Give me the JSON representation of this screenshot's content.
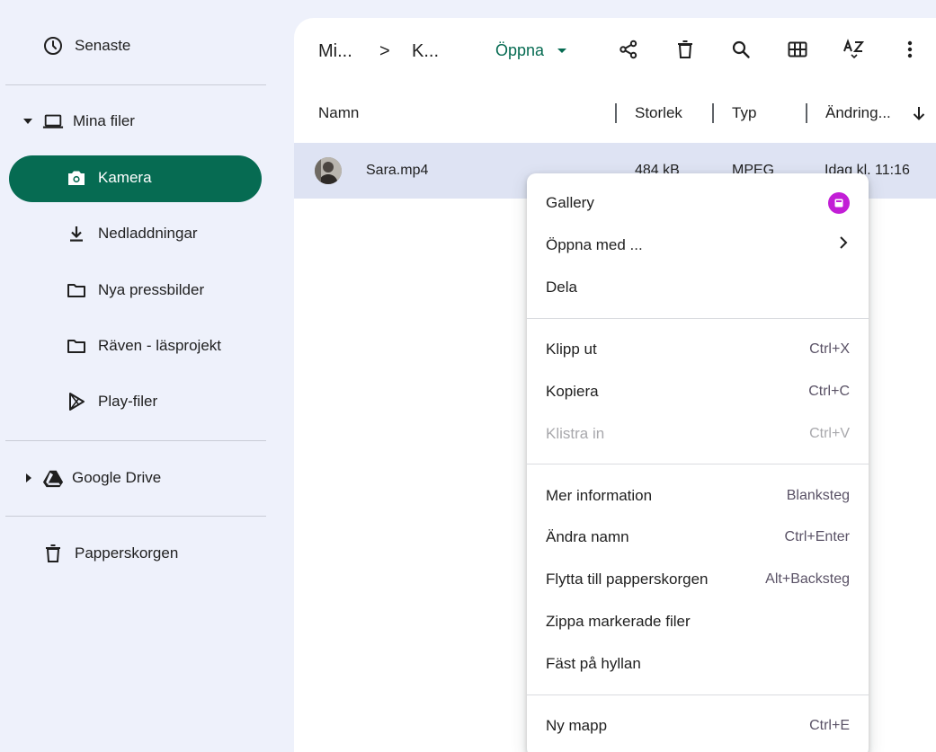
{
  "sidebar": {
    "recent": "Senaste",
    "my_files": "Mina filer",
    "items": [
      {
        "label": "Kamera"
      },
      {
        "label": "Nedladdningar"
      },
      {
        "label": "Nya pressbilder"
      },
      {
        "label": "Räven - läsprojekt"
      },
      {
        "label": "Play-filer"
      }
    ],
    "google_drive": "Google Drive",
    "trash": "Papperskorgen"
  },
  "toolbar": {
    "crumb1": "Mi...",
    "crumb_sep": ">",
    "crumb2": "K...",
    "open_label": "Öppna"
  },
  "columns": {
    "name": "Namn",
    "size": "Storlek",
    "type": "Typ",
    "modified": "Ändring..."
  },
  "files": [
    {
      "name": "Sara.mp4",
      "size": "484 kB",
      "type": "MPEG",
      "modified": "Idag kl. 11:16"
    }
  ],
  "context_menu": {
    "gallery": "Gallery",
    "open_with": "Öppna med ...",
    "share": "Dela",
    "cut": {
      "label": "Klipp ut",
      "shortcut": "Ctrl+X"
    },
    "copy": {
      "label": "Kopiera",
      "shortcut": "Ctrl+C"
    },
    "paste": {
      "label": "Klistra in",
      "shortcut": "Ctrl+V"
    },
    "info": {
      "label": "Mer information",
      "shortcut": "Blanksteg"
    },
    "rename": {
      "label": "Ändra namn",
      "shortcut": "Ctrl+Enter"
    },
    "move_trash": {
      "label": "Flytta till papperskorgen",
      "shortcut": "Alt+Backsteg"
    },
    "zip": {
      "label": "Zippa markerade filer"
    },
    "pin": {
      "label": "Fäst på hyllan"
    },
    "new_folder": {
      "label": "Ny mapp",
      "shortcut": "Ctrl+E"
    }
  },
  "colors": {
    "accent": "#066b52",
    "selection": "#dee3f3",
    "sidebar_bg": "#eef1fb",
    "gallery_icon": "#c21ed6"
  }
}
